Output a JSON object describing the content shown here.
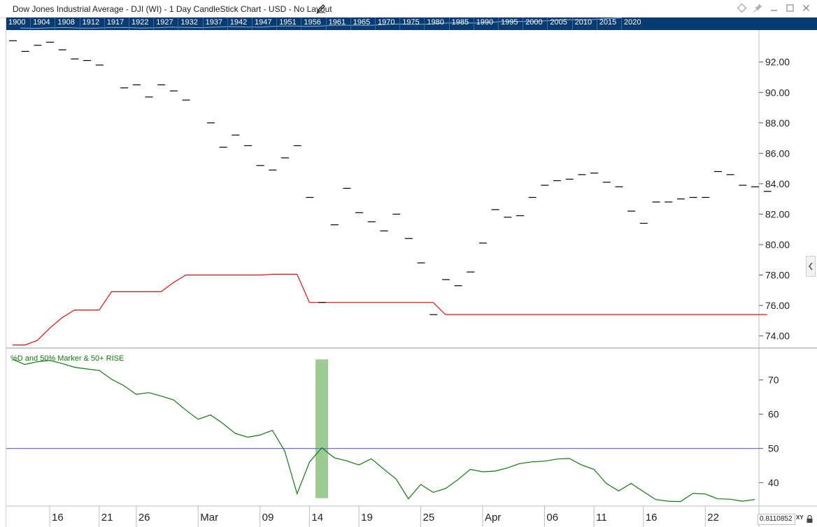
{
  "header": {
    "title": "Dow Jones Industrial Average - DJI (WI) - 1 Day CandleStick Chart - USD - No Layout",
    "icons": [
      "pencil-icon",
      "diamond-icon",
      "pin-icon",
      "minimize-icon",
      "maximize-icon",
      "close-icon"
    ]
  },
  "year_bar": {
    "years": [
      "1900",
      "1904",
      "1908",
      "1912",
      "1917",
      "1922",
      "1927",
      "1932",
      "1937",
      "1942",
      "1947",
      "1951",
      "1956",
      "1961",
      "1965",
      "1970",
      "1975",
      "1980",
      "1985",
      "1990",
      "1995",
      "2000",
      "2005",
      "2010",
      "2015",
      "2020"
    ]
  },
  "colors": {
    "year_bar": "#063b73",
    "price_marks": "#000000",
    "red_line": "#e01010",
    "oscillator_line": "#0f7a0f",
    "marker_line": "#7070e0",
    "highlight_bar": "#9ccc94",
    "indicator_label": "#0f7a0f"
  },
  "chart_data": [
    {
      "type": "line",
      "panel": "price",
      "y_ticks": [
        "92.00",
        "90.00",
        "88.00",
        "86.00",
        "84.00",
        "82.00",
        "80.00",
        "78.00",
        "76.00",
        "74.00"
      ],
      "ylim": [
        73.2,
        94.1
      ],
      "x_ticks": [
        {
          "label": "16",
          "index": 3
        },
        {
          "label": "21",
          "index": 7
        },
        {
          "label": "26",
          "index": 10
        },
        {
          "label": "Mar",
          "index": 15
        },
        {
          "label": "09",
          "index": 20
        },
        {
          "label": "14",
          "index": 24
        },
        {
          "label": "19",
          "index": 28
        },
        {
          "label": "25",
          "index": 33
        },
        {
          "label": "Apr",
          "index": 38
        },
        {
          "label": "06",
          "index": 43
        },
        {
          "label": "11",
          "index": 47
        },
        {
          "label": "16",
          "index": 51
        },
        {
          "label": "22",
          "index": 56
        }
      ],
      "x_count": 61,
      "series": [
        {
          "style": "ticks",
          "values": [
            93.4,
            92.7,
            93.1,
            93.3,
            92.8,
            92.2,
            92.1,
            91.8,
            null,
            90.3,
            90.5,
            89.7,
            90.5,
            90.1,
            89.5,
            null,
            88.0,
            86.4,
            87.2,
            86.5,
            85.2,
            84.9,
            85.7,
            86.5,
            83.1,
            76.2,
            81.3,
            83.7,
            82.1,
            81.5,
            80.9,
            82.0,
            80.4,
            78.8,
            75.4,
            77.7,
            77.3,
            78.2,
            80.1,
            82.3,
            81.8,
            81.9,
            83.1,
            83.9,
            84.2,
            84.3,
            84.6,
            84.7,
            84.1,
            83.8,
            82.2,
            81.4,
            82.8,
            82.8,
            83.0,
            83.1,
            83.1,
            84.8,
            84.6,
            83.9,
            83.8,
            83.5
          ]
        },
        {
          "style": "line",
          "values": [
            73.4,
            73.4,
            73.7,
            74.5,
            75.2,
            75.7,
            75.7,
            75.7,
            76.9,
            76.9,
            76.9,
            76.9,
            76.9,
            77.5,
            78.0,
            78.0,
            78.0,
            78.0,
            78.0,
            78.0,
            78.0,
            78.05,
            78.05,
            78.05,
            76.2,
            76.2,
            76.2,
            76.2,
            76.2,
            76.2,
            76.2,
            76.2,
            76.2,
            76.2,
            76.2,
            75.4,
            75.4,
            75.4,
            75.4,
            75.4,
            75.4,
            75.4,
            75.4,
            75.4,
            75.4,
            75.4,
            75.4,
            75.4,
            75.4,
            75.4,
            75.4,
            75.4,
            75.4,
            75.4,
            75.4,
            75.4,
            75.4,
            75.4,
            75.4,
            75.4,
            75.4,
            75.4
          ]
        }
      ]
    },
    {
      "type": "line",
      "panel": "indicator",
      "title": "%D and 50% Marker & 50+ RISE",
      "y_ticks": [
        "70",
        "60",
        "50",
        "40"
      ],
      "ylim": [
        33.2,
        79.3
      ],
      "reference_line": 50,
      "highlight_index": 25,
      "highlight_range": [
        35.5,
        76
      ],
      "series": [
        {
          "values": [
            76,
            74.5,
            75.3,
            75.7,
            74.8,
            73.7,
            73.2,
            72.8,
            70.2,
            68.3,
            65.8,
            66.3,
            65.3,
            64.2,
            61.2,
            58.5,
            59.8,
            57.3,
            54.4,
            53.3,
            53.9,
            55.3,
            49.3,
            36.8,
            46,
            50.2,
            47.3,
            46.4,
            45.2,
            47,
            44,
            41.1,
            35.3,
            39.5,
            37.2,
            38.3,
            40.9,
            43.9,
            43.2,
            43.4,
            44.3,
            45.6,
            46.1,
            46.3,
            46.9,
            47.1,
            45.2,
            43.9,
            39.8,
            37.6,
            39.8,
            37.4,
            35.1,
            34.6,
            34.5,
            36.9,
            36.7,
            35.3,
            35.2,
            34.6,
            35.1
          ]
        }
      ]
    }
  ],
  "footer": {
    "readout": "0.8110852",
    "xy_label": "XY"
  }
}
